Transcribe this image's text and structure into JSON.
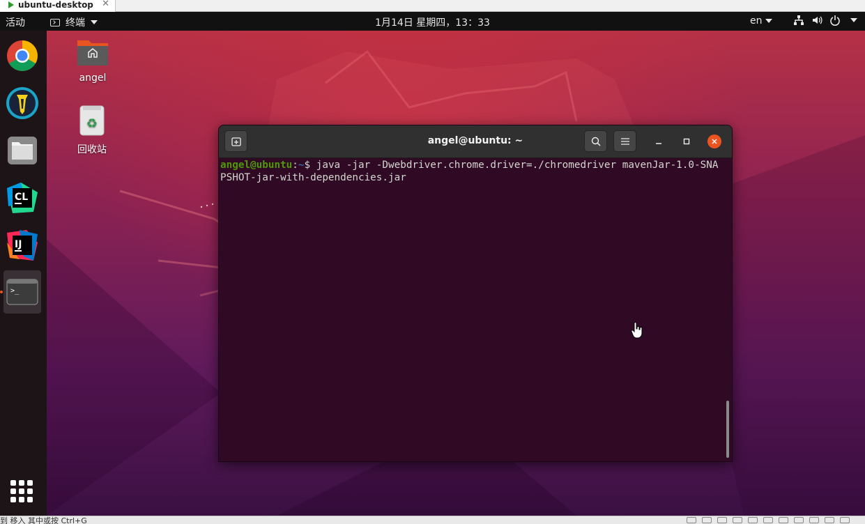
{
  "host": {
    "tab_title": "ubuntu-desktop",
    "tab_close": "✕",
    "status_text": "到 移入 其中或按 Ctrl+G"
  },
  "topbar": {
    "activities": "活动",
    "app_menu": "终端",
    "clock": "1月14日 星期四，13：33",
    "language": "en"
  },
  "dock": {
    "items": [
      "google-chrome",
      "app-2",
      "files",
      "clion",
      "intellij-idea",
      "terminal"
    ],
    "active": "terminal"
  },
  "desktop_icons": [
    {
      "label": "angel"
    },
    {
      "label": "回收站"
    }
  ],
  "terminal": {
    "title": "angel@ubuntu: ~",
    "prompt_user": "angel@ubuntu",
    "prompt_sep": ":",
    "prompt_path": "~",
    "prompt_symbol": "$ ",
    "command": "java -jar -Dwebdriver.chrome.driver=./chromedriver mavenJar-1.0-SNAPSHOT-jar-with-dependencies.jar"
  },
  "colors": {
    "terminal_bg": "#300a24",
    "prompt_user": "#4e9a06",
    "prompt_path": "#3465a4",
    "accent": "#e95420"
  }
}
